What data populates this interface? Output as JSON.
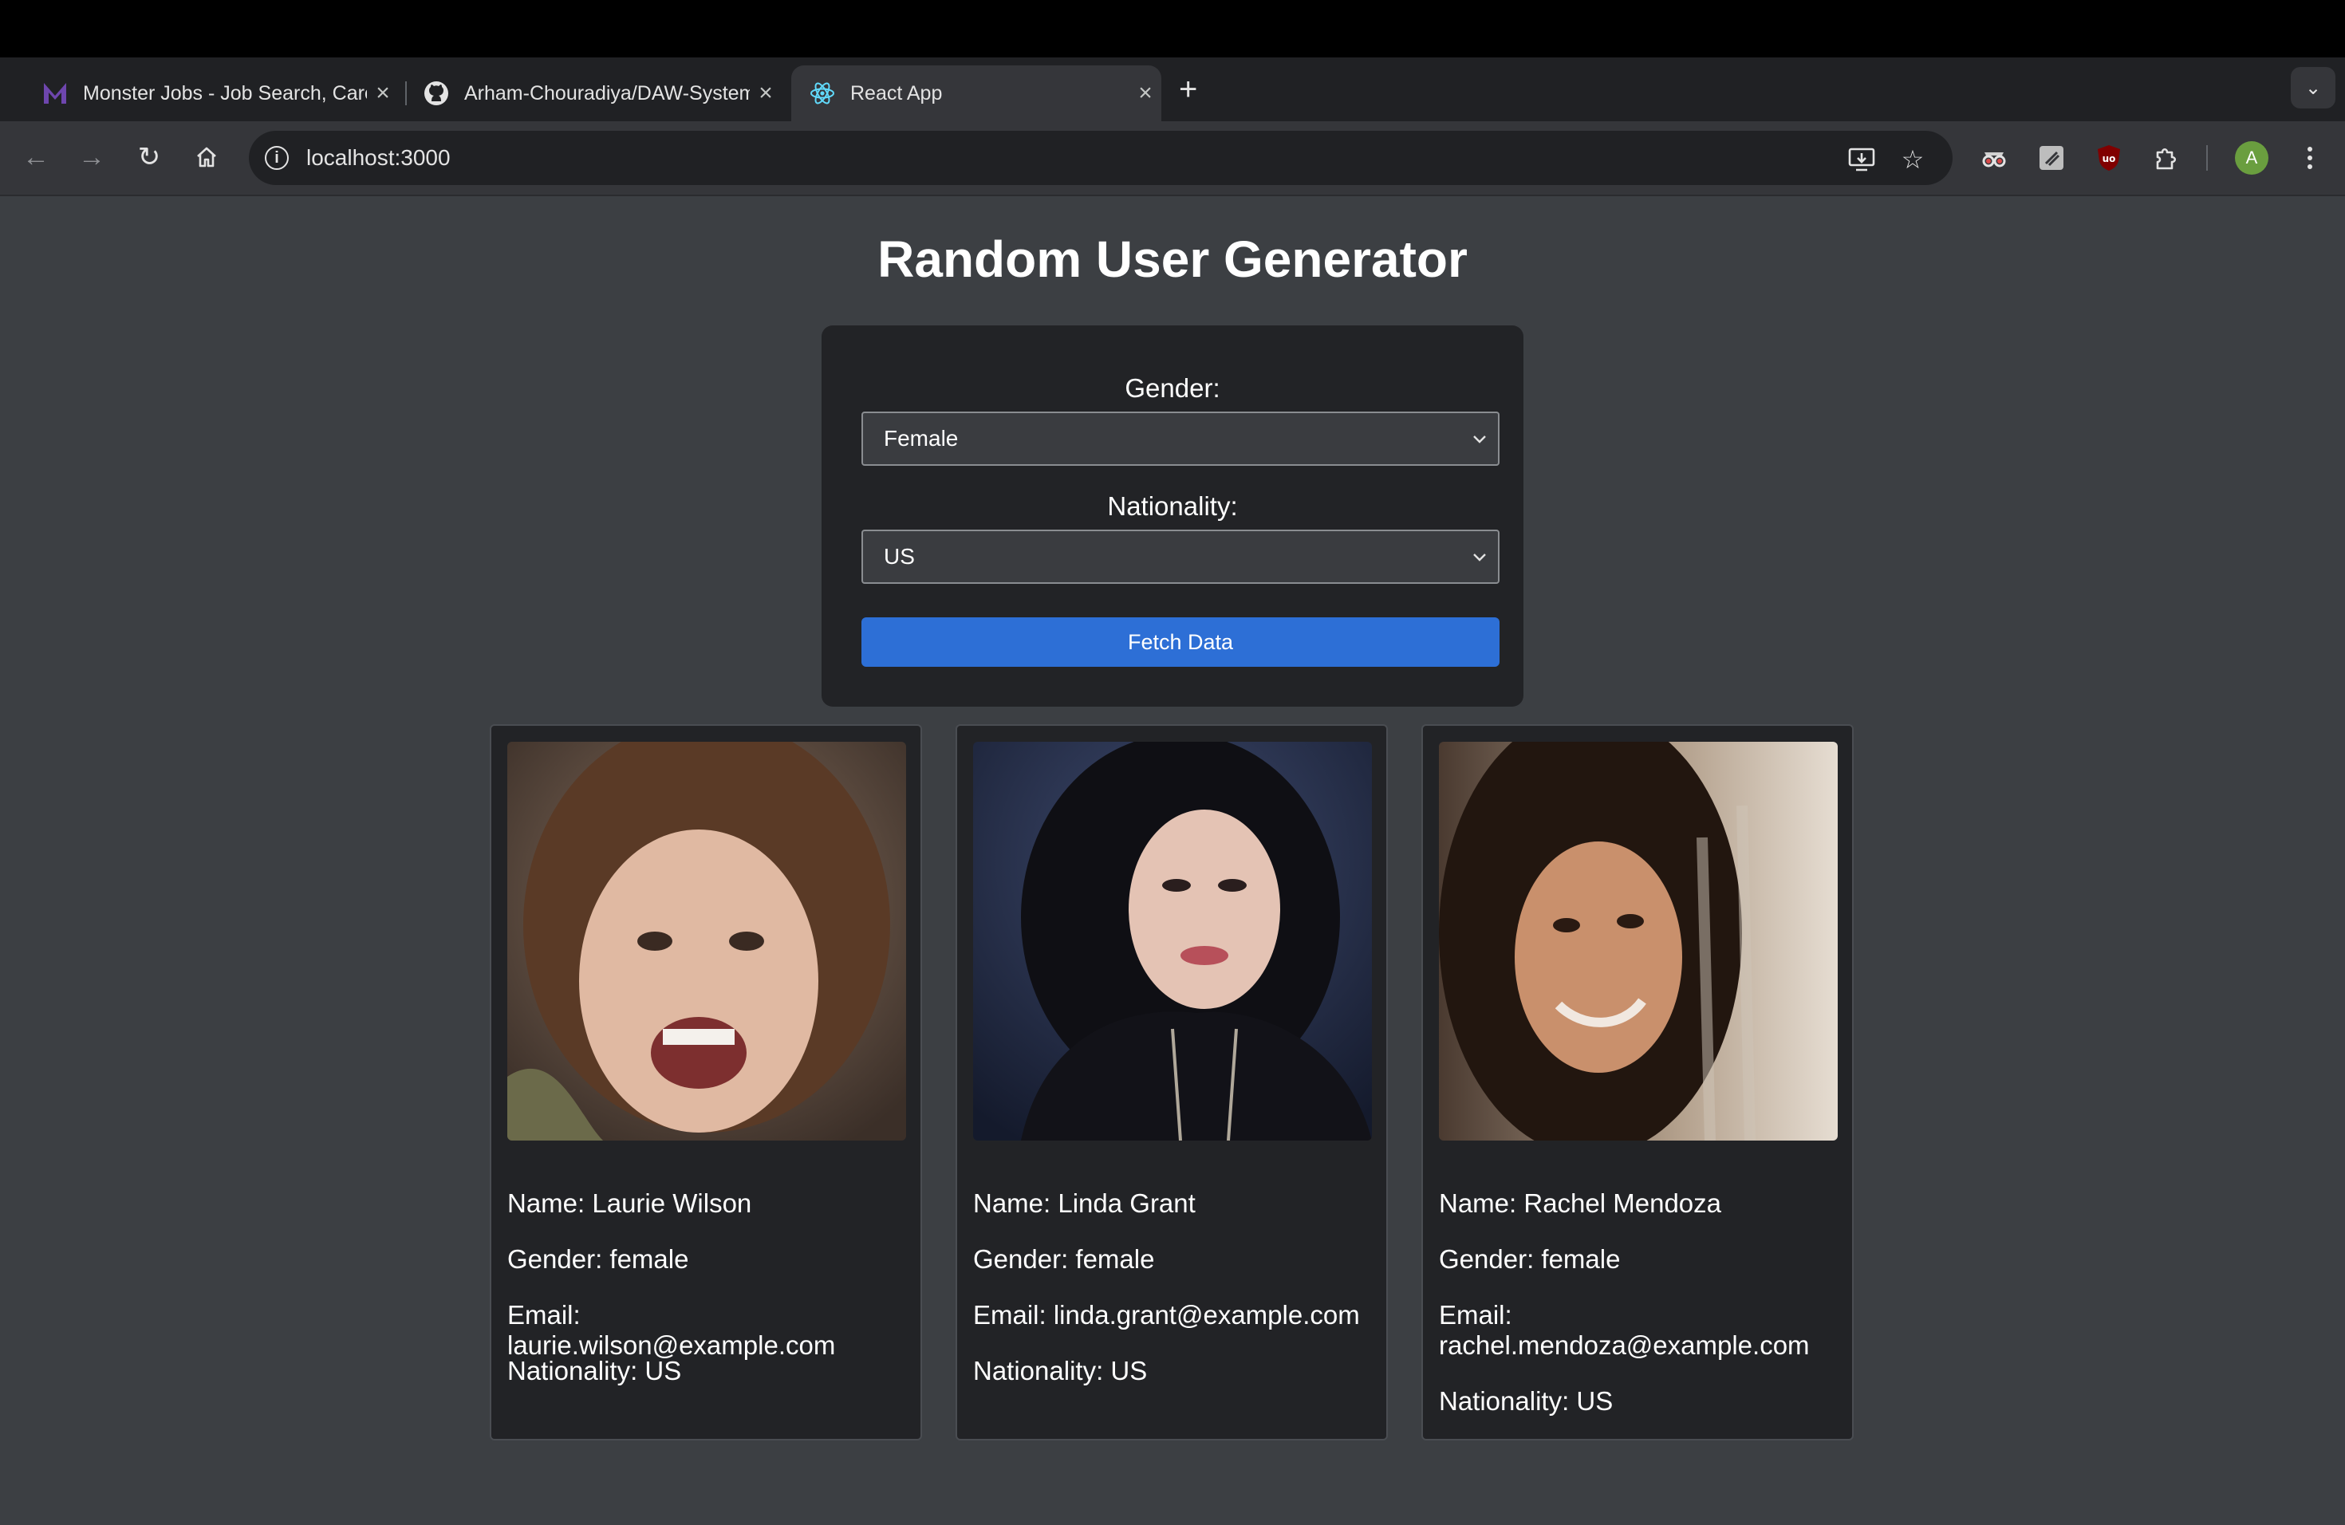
{
  "browser": {
    "tabs": [
      {
        "title": "Monster Jobs - Job Search, Career Advice & Hiring Resources",
        "favicon": "monster-m-icon"
      },
      {
        "title": "Arham-Chouradiya/DAW-System",
        "favicon": "github-icon"
      },
      {
        "title": "React App",
        "favicon": "react-icon"
      }
    ],
    "active_tab": 2,
    "url": "localhost:3000",
    "profile_initial": "A"
  },
  "page": {
    "title": "Random User Generator",
    "form": {
      "gender_label": "Gender:",
      "gender_value": "Female",
      "nationality_label": "Nationality:",
      "nationality_value": "US",
      "fetch_button": "Fetch Data"
    },
    "users": [
      {
        "name": "Name: Laurie Wilson",
        "gender": "Gender: female",
        "email": "Email: laurie.wilson@example.com",
        "nationality": "Nationality: US"
      },
      {
        "name": "Name: Linda Grant",
        "gender": "Gender: female",
        "email": "Email: linda.grant@example.com",
        "nationality": "Nationality: US"
      },
      {
        "name": "Name: Rachel Mendoza",
        "gender": "Gender: female",
        "email": "Email: rachel.mendoza@example.com",
        "nationality": "Nationality: US"
      }
    ]
  },
  "colors": {
    "page_bg": "#3c3f43",
    "panel_bg": "#222326",
    "accent_button": "#2d6fd6"
  }
}
